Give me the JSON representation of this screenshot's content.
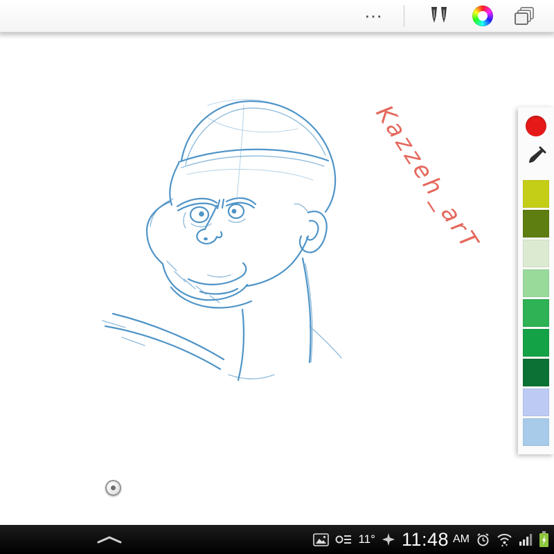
{
  "toolbar": {
    "more_label": "⋯"
  },
  "sketch": {
    "color": "#4f94c7",
    "description": "blue pencil sketch of a bald man's head in three-quarter view"
  },
  "watermark": {
    "text": "Kazzeh_arT",
    "color": "#e4685c"
  },
  "palette": {
    "current_color": "#e51a18",
    "swatches": [
      "#c5ce17",
      "#5f7e12",
      "#dcead2",
      "#99da9b",
      "#2fb155",
      "#14a246",
      "#0b7134",
      "#bdcaf4",
      "#a7cbe9"
    ]
  },
  "statusbar": {
    "temperature": "11°",
    "time": "11:48",
    "meridiem": "AM",
    "battery_color": "#8dc63f"
  },
  "icons": {
    "toolbar": [
      "more-options-icon",
      "pens-icon",
      "color-wheel-icon",
      "layers-icon"
    ],
    "palette": [
      "current-color-swatch",
      "eyedropper-icon"
    ],
    "statusbar": [
      "gallery-icon",
      "memo-icon",
      "weather-icon",
      "alarm-icon",
      "wifi-icon",
      "signal-icon",
      "battery-icon"
    ],
    "nav": [
      "chevron-up-icon"
    ]
  }
}
